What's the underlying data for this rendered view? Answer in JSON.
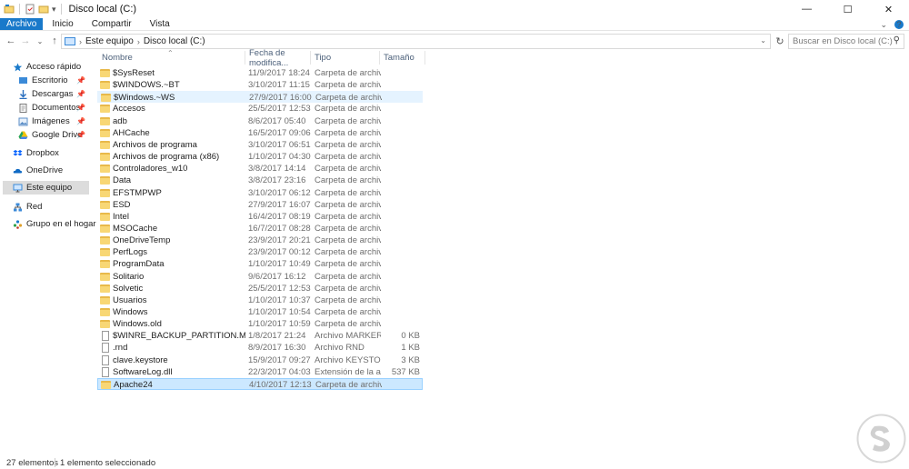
{
  "window": {
    "title": "Disco local (C:)",
    "minimize": "—",
    "maximize": "☐",
    "close": "✕"
  },
  "ribbon": {
    "tabs": [
      "Archivo",
      "Inicio",
      "Compartir",
      "Vista"
    ],
    "accent": "#1979ca",
    "collapse_glyph": "⌄",
    "help_glyph": "?"
  },
  "nav": {
    "back": "←",
    "forward": "→",
    "recent": "⌄",
    "up": "↑",
    "breadcrumb": [
      "Este equipo",
      "Disco local (C:)"
    ],
    "search_placeholder": "Buscar en Disco local (C:)"
  },
  "navpane": {
    "items": [
      {
        "label": "Acceso rápido",
        "icon": "star-icon"
      },
      {
        "label": "Escritorio",
        "icon": "desktop-icon",
        "pinned": true
      },
      {
        "label": "Descargas",
        "icon": "download-icon",
        "pinned": true
      },
      {
        "label": "Documentos",
        "icon": "document-icon",
        "pinned": true
      },
      {
        "label": "Imágenes",
        "icon": "pictures-icon",
        "pinned": true
      },
      {
        "label": "Google Drive",
        "icon": "google-drive-icon",
        "pinned": true
      },
      {
        "label": "Dropbox",
        "icon": "dropbox-icon"
      },
      {
        "label": "OneDrive",
        "icon": "onedrive-icon"
      },
      {
        "label": "Este equipo",
        "icon": "computer-icon",
        "selected": true
      },
      {
        "label": "Red",
        "icon": "network-icon"
      },
      {
        "label": "Grupo en el hogar",
        "icon": "homegroup-icon"
      }
    ]
  },
  "columns": {
    "name": "Nombre",
    "date": "Fecha de modifica...",
    "type": "Tipo",
    "size": "Tamaño"
  },
  "files": [
    {
      "name": "$SysReset",
      "date": "11/9/2017 18:24",
      "type": "Carpeta de archivos",
      "size": "",
      "kind": "folder"
    },
    {
      "name": "$WINDOWS.~BT",
      "date": "3/10/2017 11:15",
      "type": "Carpeta de archivos",
      "size": "",
      "kind": "folder"
    },
    {
      "name": "$Windows.~WS",
      "date": "27/9/2017 16:00",
      "type": "Carpeta de archivos",
      "size": "",
      "kind": "folder",
      "state": "hover"
    },
    {
      "name": "Accesos",
      "date": "25/5/2017 12:53",
      "type": "Carpeta de archivos",
      "size": "",
      "kind": "folder"
    },
    {
      "name": "adb",
      "date": "8/6/2017 05:40",
      "type": "Carpeta de archivos",
      "size": "",
      "kind": "folder"
    },
    {
      "name": "AHCache",
      "date": "16/5/2017 09:06",
      "type": "Carpeta de archivos",
      "size": "",
      "kind": "folder"
    },
    {
      "name": "Archivos de programa",
      "date": "3/10/2017 06:51",
      "type": "Carpeta de archivos",
      "size": "",
      "kind": "folder"
    },
    {
      "name": "Archivos de programa (x86)",
      "date": "1/10/2017 04:30",
      "type": "Carpeta de archivos",
      "size": "",
      "kind": "folder"
    },
    {
      "name": "Controladores_w10",
      "date": "3/8/2017 14:14",
      "type": "Carpeta de archivos",
      "size": "",
      "kind": "folder"
    },
    {
      "name": "Data",
      "date": "3/8/2017 23:16",
      "type": "Carpeta de archivos",
      "size": "",
      "kind": "folder"
    },
    {
      "name": "EFSTMPWP",
      "date": "3/10/2017 06:12",
      "type": "Carpeta de archivos",
      "size": "",
      "kind": "folder"
    },
    {
      "name": "ESD",
      "date": "27/9/2017 16:07",
      "type": "Carpeta de archivos",
      "size": "",
      "kind": "folder"
    },
    {
      "name": "Intel",
      "date": "16/4/2017 08:19",
      "type": "Carpeta de archivos",
      "size": "",
      "kind": "folder"
    },
    {
      "name": "MSOCache",
      "date": "16/7/2017 08:28",
      "type": "Carpeta de archivos",
      "size": "",
      "kind": "folder"
    },
    {
      "name": "OneDriveTemp",
      "date": "23/9/2017 20:21",
      "type": "Carpeta de archivos",
      "size": "",
      "kind": "folder"
    },
    {
      "name": "PerfLogs",
      "date": "23/9/2017 00:12",
      "type": "Carpeta de archivos",
      "size": "",
      "kind": "folder"
    },
    {
      "name": "ProgramData",
      "date": "1/10/2017 10:49",
      "type": "Carpeta de archivos",
      "size": "",
      "kind": "folder"
    },
    {
      "name": "Solitario",
      "date": "9/6/2017 16:12",
      "type": "Carpeta de archivos",
      "size": "",
      "kind": "folder"
    },
    {
      "name": "Solvetic",
      "date": "25/5/2017 12:53",
      "type": "Carpeta de archivos",
      "size": "",
      "kind": "folder"
    },
    {
      "name": "Usuarios",
      "date": "1/10/2017 10:37",
      "type": "Carpeta de archivos",
      "size": "",
      "kind": "folder"
    },
    {
      "name": "Windows",
      "date": "1/10/2017 10:54",
      "type": "Carpeta de archivos",
      "size": "",
      "kind": "folder"
    },
    {
      "name": "Windows.old",
      "date": "1/10/2017 10:59",
      "type": "Carpeta de archivos",
      "size": "",
      "kind": "folder"
    },
    {
      "name": "$WINRE_BACKUP_PARTITION.MARKER",
      "date": "1/8/2017 21:24",
      "type": "Archivo MARKER",
      "size": "0 KB",
      "kind": "file"
    },
    {
      "name": ".rnd",
      "date": "8/9/2017 16:30",
      "type": "Archivo RND",
      "size": "1 KB",
      "kind": "file"
    },
    {
      "name": "clave.keystore",
      "date": "15/9/2017 09:27",
      "type": "Archivo KEYSTORE",
      "size": "3 KB",
      "kind": "file"
    },
    {
      "name": "SoftwareLog.dll",
      "date": "22/3/2017 04:03",
      "type": "Extensión de la apl...",
      "size": "537 KB",
      "kind": "file"
    },
    {
      "name": "Apache24",
      "date": "4/10/2017 12:13",
      "type": "Carpeta de archivos",
      "size": "",
      "kind": "folder",
      "state": "selected"
    }
  ],
  "status": {
    "count": "27 elementos",
    "selection": "1 elemento seleccionado"
  }
}
